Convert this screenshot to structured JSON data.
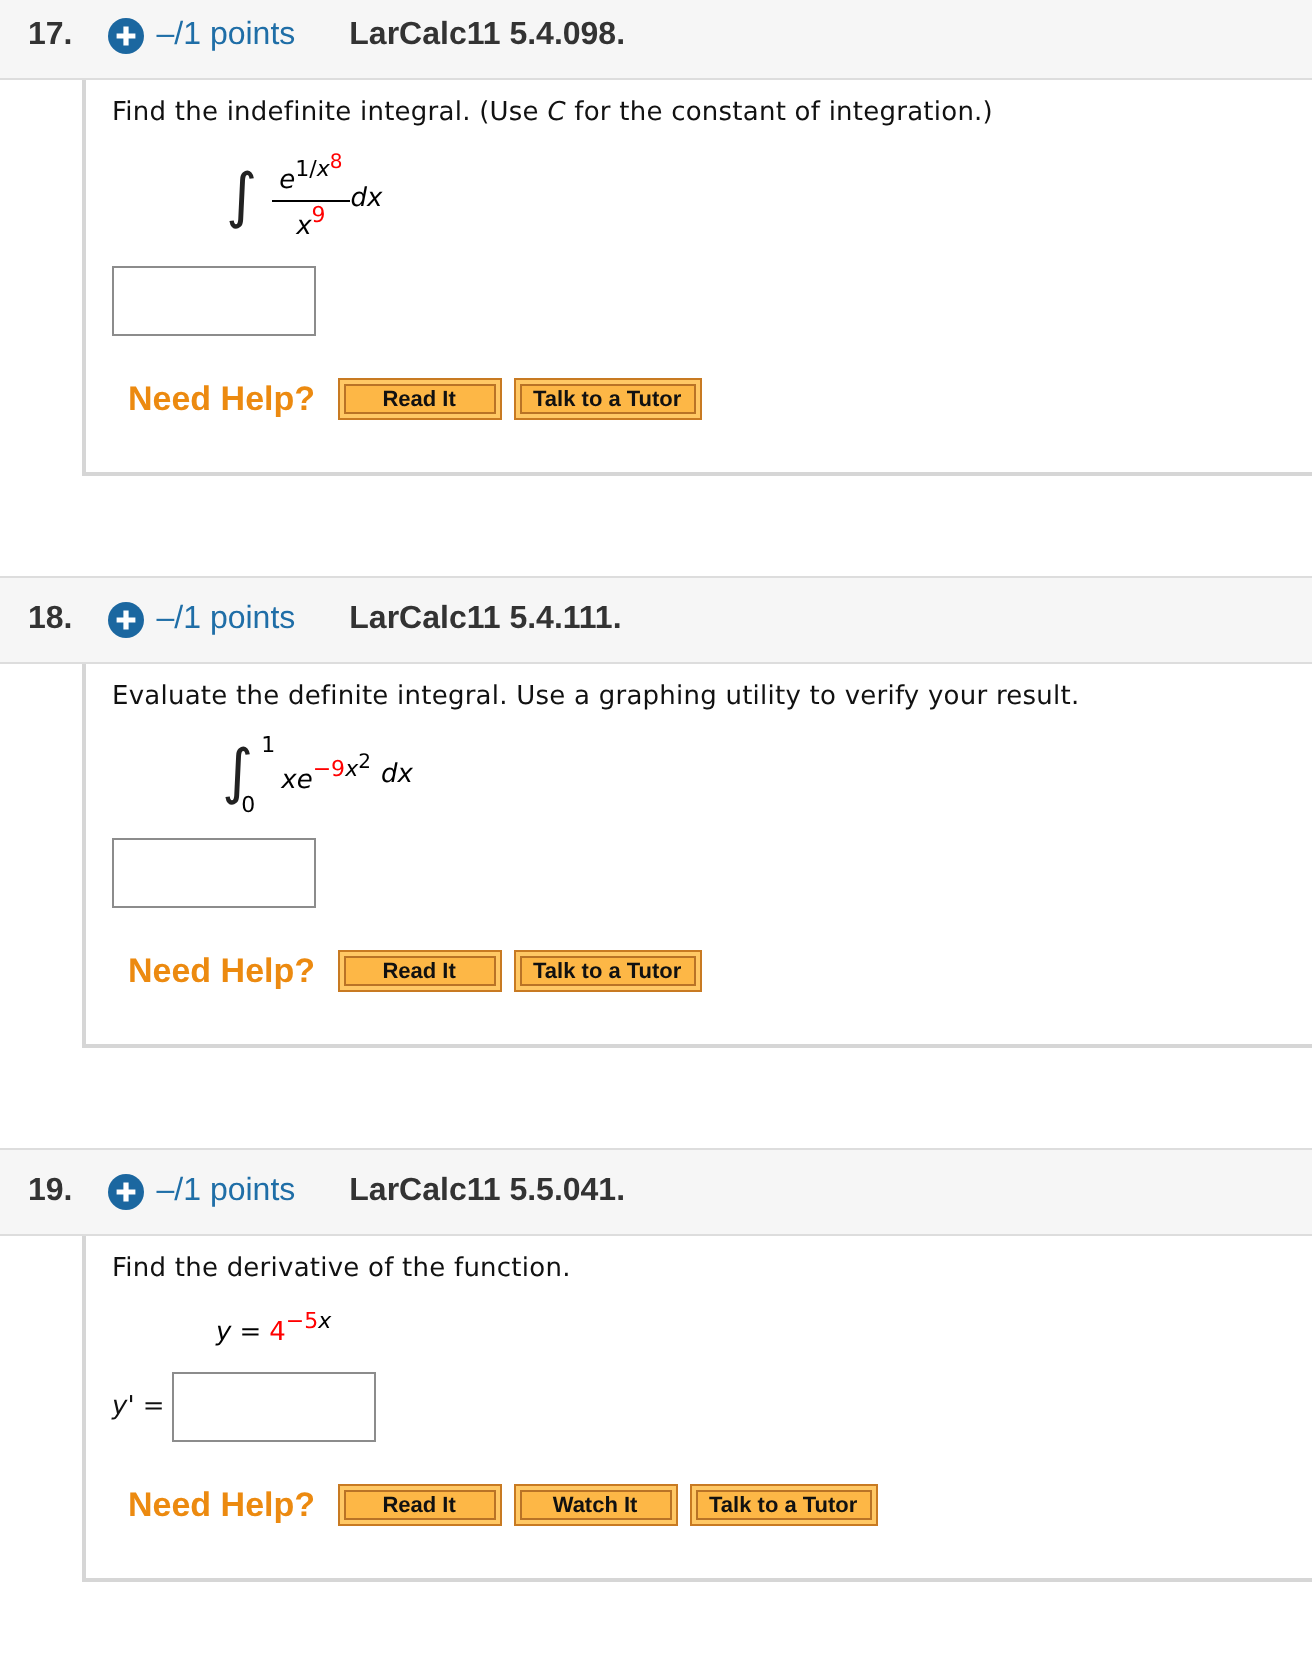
{
  "problems": [
    {
      "number": "17.",
      "points": "–/1 points",
      "problem_id": "LarCalc11 5.4.098.",
      "question": "Find the indefinite integral. (Use *C* for the constant of integration.)",
      "formula": {
        "kind": "fraction_integral",
        "integral_sign": "∫",
        "numerator": [
          {
            "text": "e",
            "kind": "base",
            "italic": true,
            "color": "#000000"
          },
          {
            "text": "1/",
            "kind": "sup",
            "italic": false,
            "color": "#000000"
          },
          {
            "text": "x",
            "kind": "sup",
            "italic": true,
            "color": "#000000"
          },
          {
            "text": "8",
            "kind": "sup2",
            "italic": false,
            "color": "#ff0000"
          }
        ],
        "denominator": [
          {
            "text": "x",
            "kind": "base",
            "italic": true,
            "color": "#000000"
          },
          {
            "text": "9",
            "kind": "sup",
            "italic": false,
            "color": "#ff0000"
          }
        ],
        "differential": "dx"
      },
      "help_label": "Need Help?",
      "help_buttons": [
        "Read It",
        "Talk to a Tutor"
      ]
    },
    {
      "number": "18.",
      "points": "–/1 points",
      "problem_id": "LarCalc11 5.4.111.",
      "question": "Evaluate the definite integral. Use a graphing utility to verify your result.",
      "formula": {
        "kind": "definite_integral",
        "integral_sign": "∫",
        "upper_limit": "1",
        "lower_limit": "0",
        "integrand": [
          {
            "text": "xe",
            "kind": "base",
            "italic": true,
            "color": "#000000"
          },
          {
            "text": "−9",
            "kind": "sup",
            "italic": false,
            "color": "#ff0000"
          },
          {
            "text": "x",
            "kind": "sup",
            "italic": true,
            "color": "#000000"
          },
          {
            "text": "2",
            "kind": "sup2",
            "italic": false,
            "color": "#000000"
          }
        ],
        "differential": "dx"
      },
      "help_label": "Need Help?",
      "help_buttons": [
        "Read It",
        "Talk to a Tutor"
      ]
    },
    {
      "number": "19.",
      "points": "–/1 points",
      "problem_id": "LarCalc11 5.5.041.",
      "question": "Find the derivative of the function.",
      "formula": {
        "kind": "equation",
        "lhs": "y",
        "relation": "=",
        "rhs": [
          {
            "text": "4",
            "kind": "base",
            "italic": false,
            "color": "#ff0000"
          },
          {
            "text": "−5",
            "kind": "sup",
            "italic": false,
            "color": "#ff0000"
          },
          {
            "text": "x",
            "kind": "sup",
            "italic": true,
            "color": "#000000"
          }
        ]
      },
      "answer_label": "*y*' =",
      "help_label": "Need Help?",
      "help_buttons": [
        "Read It",
        "Watch It",
        "Talk to a Tutor"
      ]
    }
  ]
}
